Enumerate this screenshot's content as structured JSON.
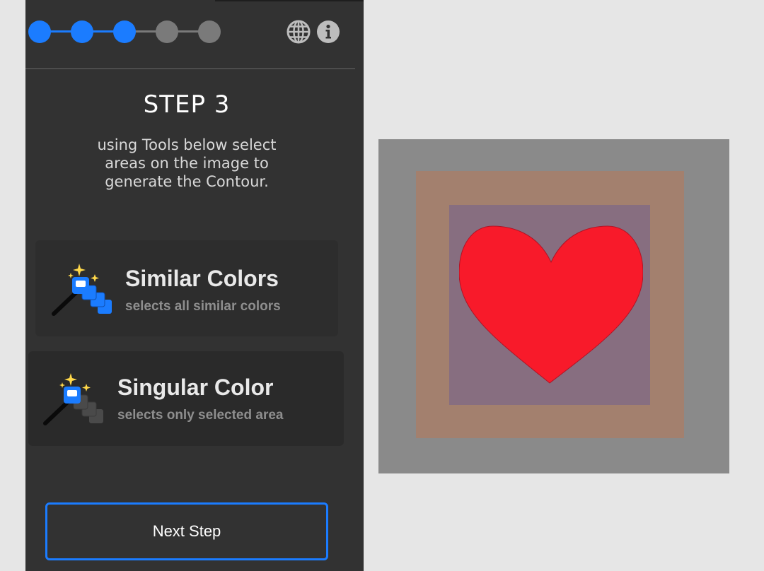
{
  "progress": {
    "steps_total": 5,
    "steps_done": 3,
    "active_color": "#1b7cff",
    "inactive_color": "#7a7a7a"
  },
  "header": {
    "icons": [
      "globe-icon",
      "info-icon"
    ]
  },
  "step": {
    "title": "STEP 3",
    "description": "using Tools below select areas on the image to generate the Contour."
  },
  "tools": [
    {
      "title": "Similar Colors",
      "subtitle": "selects all similar colors",
      "icon": "magic-wand-similar-icon"
    },
    {
      "title": "Singular Color",
      "subtitle": "selects only selected area",
      "icon": "magic-wand-singular-icon"
    }
  ],
  "actions": {
    "next_label": "Next Step"
  },
  "canvas": {
    "outer_color": "#8a8a8a",
    "ring_color": "#a3806e",
    "inner_color": "#876e80",
    "heart_color": "#f81a2a"
  }
}
